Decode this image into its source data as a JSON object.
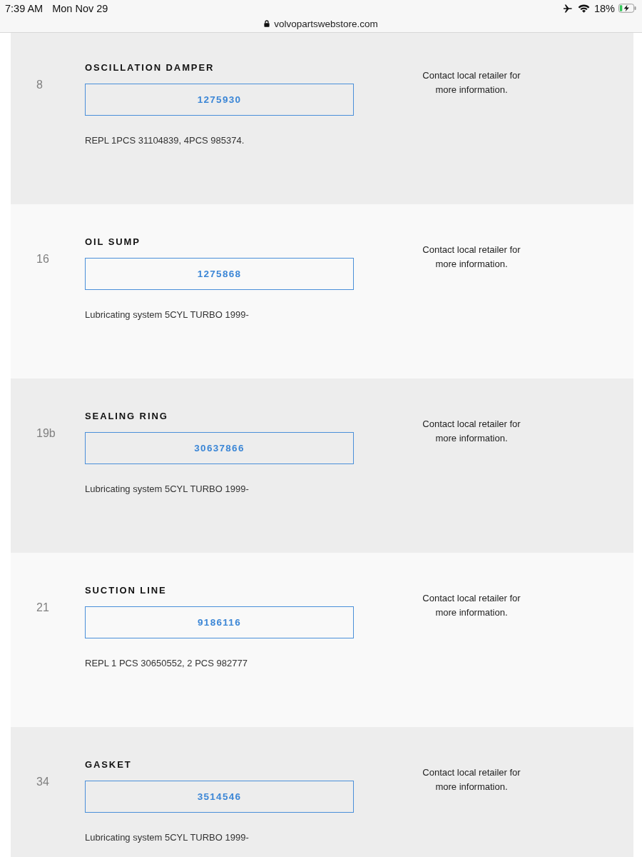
{
  "status_bar": {
    "time": "7:39 AM",
    "date": "Mon Nov 29",
    "battery_percent": "18%"
  },
  "address_bar": {
    "url": "volvopartswebstore.com"
  },
  "parts": [
    {
      "ref": "8",
      "name": "OSCILLATION DAMPER",
      "part_number": "1275930",
      "note": "REPL 1PCS 31104839, 4PCS 985374.",
      "availability": "Contact local retailer for more information."
    },
    {
      "ref": "16",
      "name": "OIL SUMP",
      "part_number": "1275868",
      "note": "Lubricating system 5CYL TURBO 1999-",
      "availability": "Contact local retailer for more information."
    },
    {
      "ref": "19b",
      "name": "SEALING RING",
      "part_number": "30637866",
      "note": "Lubricating system 5CYL TURBO 1999-",
      "availability": "Contact local retailer for more information."
    },
    {
      "ref": "21",
      "name": "SUCTION LINE",
      "part_number": "9186116",
      "note": "REPL 1 PCS 30650552, 2 PCS 982777",
      "availability": "Contact local retailer for more information."
    },
    {
      "ref": "34",
      "name": "GASKET",
      "part_number": "3514546",
      "note": "Lubricating system 5CYL TURBO 1999-",
      "availability": "Contact local retailer for more information."
    }
  ]
}
